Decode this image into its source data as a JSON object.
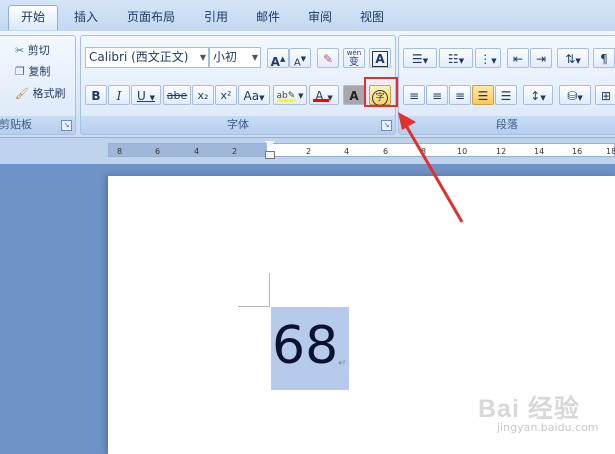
{
  "tabs": [
    "开始",
    "插入",
    "页面布局",
    "引用",
    "邮件",
    "审阅",
    "视图"
  ],
  "clipboard": {
    "cut": "剪切",
    "copy": "复制",
    "format_painter": "格式刷",
    "label": "剪贴板"
  },
  "font": {
    "name": "Calibri (西文正文)",
    "size": "小初",
    "label": "字体",
    "grow": "A",
    "shrink": "A",
    "bold": "B",
    "italic": "I",
    "underline": "U",
    "strike": "abe",
    "subscript": "x₂",
    "superscript": "x²",
    "case": "Aa",
    "wen": "wén",
    "wen_char": "变",
    "border_char": "A",
    "shade_char": "A",
    "enclose_char": "字"
  },
  "paragraph": {
    "label": "段落"
  },
  "ruler_left": [
    "8",
    "6",
    "4",
    "2"
  ],
  "ruler_right": [
    "2",
    "4",
    "6",
    "8",
    "10",
    "12",
    "14",
    "16",
    "18"
  ],
  "document": {
    "text": "68",
    "mark": "↵"
  },
  "watermark": {
    "line1": "Bai 经验",
    "line2": "jingyan.baidu.com"
  },
  "colors": {
    "highlight_bar": "#ffff00",
    "font_color_bar": "#ff0000",
    "callout": "#e03030",
    "selection": "#b6cbeb"
  }
}
